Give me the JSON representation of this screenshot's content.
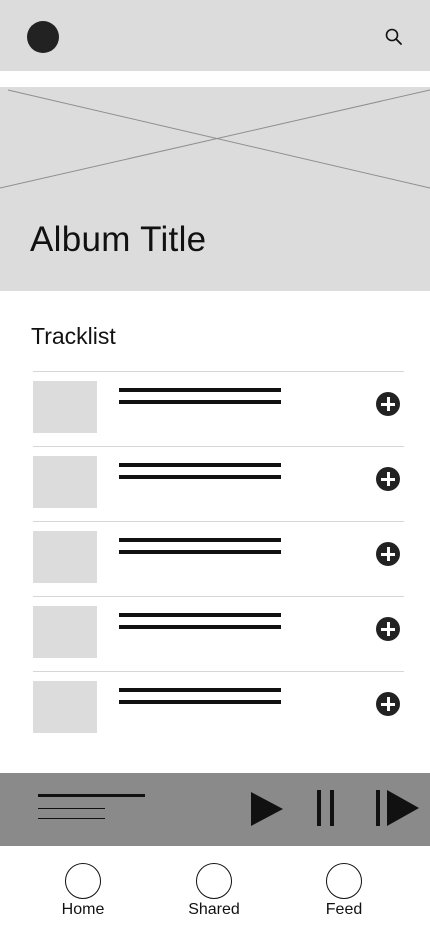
{
  "header": {
    "avatar_icon": "avatar-circle",
    "search_icon": "search-icon"
  },
  "hero": {
    "image": "image-placeholder",
    "album_title": "Album Title"
  },
  "tracklist": {
    "heading": "Tracklist",
    "tracks": [
      {
        "thumbnail": "image-placeholder",
        "add_icon": "plus-circle-icon"
      },
      {
        "thumbnail": "image-placeholder",
        "add_icon": "plus-circle-icon"
      },
      {
        "thumbnail": "image-placeholder",
        "add_icon": "plus-circle-icon"
      },
      {
        "thumbnail": "image-placeholder",
        "add_icon": "plus-circle-icon"
      },
      {
        "thumbnail": "image-placeholder",
        "add_icon": "plus-circle-icon"
      }
    ]
  },
  "player": {
    "controls": [
      "play-icon",
      "pause-icon",
      "skip-next-icon"
    ]
  },
  "bottom_nav": {
    "items": [
      {
        "label": "Home"
      },
      {
        "label": "Shared"
      },
      {
        "label": "Feed"
      }
    ]
  },
  "colors": {
    "placeholder_gray": "#dcdcdc",
    "player_gray": "#8a8a8a",
    "ink": "#111111"
  }
}
